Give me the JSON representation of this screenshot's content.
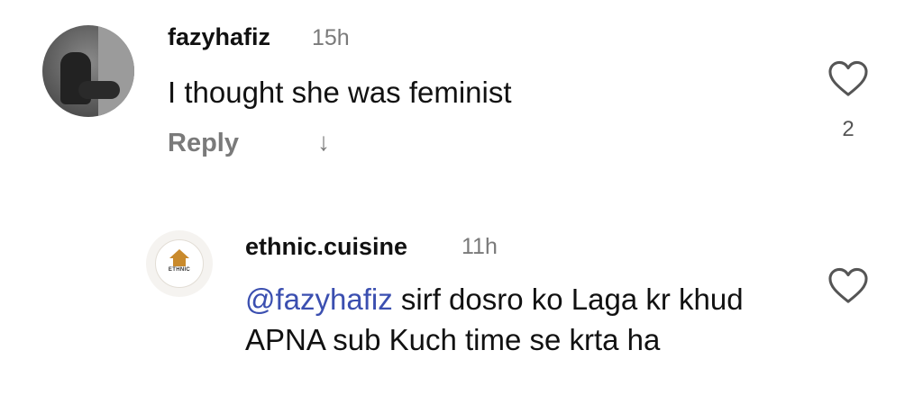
{
  "comment": {
    "username": "fazyhafiz",
    "time": "15h",
    "text": "I thought she was feminist",
    "reply_label": "Reply",
    "likes": "2"
  },
  "reply": {
    "username": "ethnic.cuisine",
    "time": "11h",
    "mention": "@fazyhafiz",
    "text": " sirf dosro ko Laga kr khud APNA sub Kuch time se krta ha",
    "avatar_logo_text": "ETHNIC",
    "logo_color": "#c98a2c"
  },
  "colors": {
    "mention": "#3b4fb0",
    "muted": "#7a7a7a"
  },
  "icons": {
    "like": "heart-icon",
    "expand": "arrow-down-icon"
  }
}
